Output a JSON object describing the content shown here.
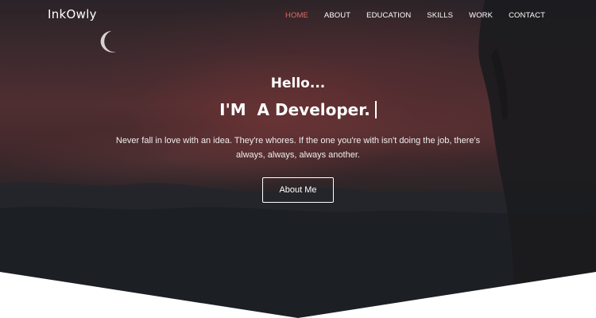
{
  "brand": "InkOwly",
  "nav": [
    {
      "label": "HOME",
      "active": true
    },
    {
      "label": "ABOUT"
    },
    {
      "label": "EDUCATION"
    },
    {
      "label": "SKILLS"
    },
    {
      "label": "WORK"
    },
    {
      "label": "CONTACT"
    }
  ],
  "hero": {
    "greeting": "Hello...",
    "headline": "I'M  A Developer.",
    "tagline": "Never fall in love with an idea. They're whores. If the one you're with isn't doing the job, there's always, always, always another.",
    "button_label": "About Me"
  },
  "colors": {
    "accent": "#e66a62",
    "overlay": "#2a2327",
    "text": "#ffffff"
  },
  "icons": [
    "moon-icon"
  ]
}
